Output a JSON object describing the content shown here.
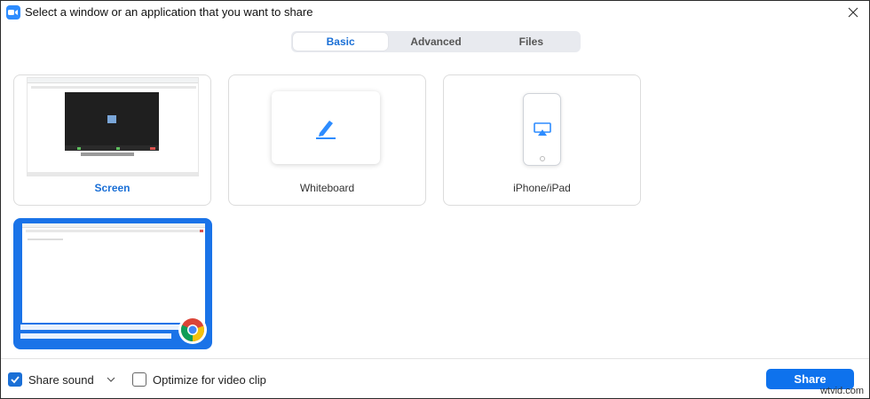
{
  "window": {
    "title": "Select a window or an application that you want to share"
  },
  "tabs": [
    {
      "label": "Basic",
      "active": true
    },
    {
      "label": "Advanced",
      "active": false
    },
    {
      "label": "Files",
      "active": false
    }
  ],
  "share_items": [
    {
      "label": "Screen",
      "selected": false,
      "type": "screen"
    },
    {
      "label": "Whiteboard",
      "selected": false,
      "type": "whiteboard"
    },
    {
      "label": "iPhone/iPad",
      "selected": false,
      "type": "device"
    }
  ],
  "app_windows": [
    {
      "app_icon": "chrome-icon",
      "selected": true
    }
  ],
  "options": {
    "share_sound": {
      "label": "Share sound",
      "checked": true
    },
    "optimize_video": {
      "label": "Optimize for video clip",
      "checked": false
    }
  },
  "share_button": {
    "label": "Share"
  },
  "watermark": "wtvid.com",
  "colors": {
    "accent": "#0e72ed",
    "tab_active_text": "#1a6fd6",
    "selected_border": "#1a73e8"
  }
}
